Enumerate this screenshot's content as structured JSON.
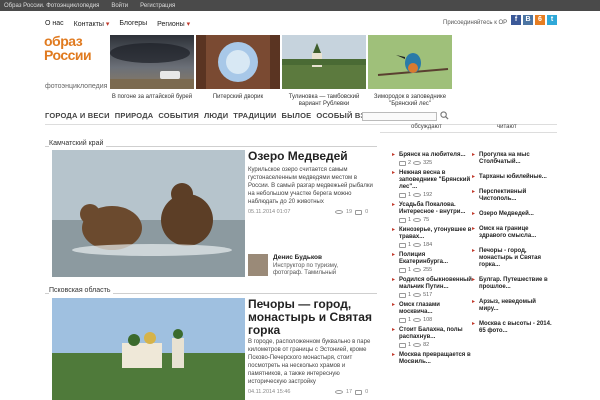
{
  "topbar": {
    "site_name": "Образ России. Фотоэнциклопедия",
    "login": "Войти",
    "register": "Регистрация"
  },
  "topnav": [
    {
      "label": "О нас",
      "dropdown": false
    },
    {
      "label": "Контакты",
      "dropdown": true
    },
    {
      "label": "Блогеры",
      "dropdown": false
    },
    {
      "label": "Регионы",
      "dropdown": true
    }
  ],
  "join_text": "Присоединяйтесь к ОР",
  "social": [
    {
      "name": "facebook-icon",
      "glyph": "f",
      "color": "#3b5998"
    },
    {
      "name": "vk-icon",
      "glyph": "В",
      "color": "#4c75a3"
    },
    {
      "name": "livejournal-icon",
      "glyph": "6",
      "color": "#e67e22"
    },
    {
      "name": "twitter-icon",
      "glyph": "t",
      "color": "#2fa8d8"
    }
  ],
  "logo": {
    "line1": "образ",
    "line2": "России",
    "subtitle": "фотоэнциклопедия",
    "color": "#e07a1f"
  },
  "featured": [
    {
      "caption": "В погоне за алтайской бурей"
    },
    {
      "caption": "Питерский дворик"
    },
    {
      "caption": "Тулиновка — тамбовский вариант Рублевки"
    },
    {
      "caption": "Зимородок в заповеднике \"Брянский лес\""
    }
  ],
  "categories": [
    "ГОРОДА И ВЕСИ",
    "ПРИРОДА",
    "СОБЫТИЯ",
    "ЛЮДИ",
    "ТРАДИЦИИ",
    "БЫЛОЕ",
    "ОСОБЫЙ ВЗГЛЯД"
  ],
  "posts": [
    {
      "region": "Камчатский край",
      "title": "Озеро Медведей",
      "excerpt": "Курильское озеро считается самым густонаселенным медведями местом в России. В самый разгар медвежьей рыбалки на небольшом участке берега можно наблюдать до 20 животных",
      "date": "05.11.2014 01:07",
      "views": "19",
      "comments": "0",
      "author_name": "Денис Будьков",
      "author_desc": "Инструктор по туризму, фотограф. Тамильный"
    },
    {
      "region": "Псковская область",
      "title": "Печоры — город, монастырь и Святая горка",
      "excerpt": "В городе, расположенном буквально в паре километров от границы с Эстонией, кроме Псково-Печерского монастыря, стоит посмотреть на несколько храмов и памятников, а также интересную историческую застройку",
      "date": "04.11.2014 15:46",
      "views": "17",
      "comments": "0"
    }
  ],
  "sidebar": {
    "discussed_header": "обсуждают",
    "read_header": "читают",
    "discussed": [
      {
        "title": "Брянск на любителя...",
        "comments": "2",
        "views": "325"
      },
      {
        "title": "Нежная весна в заповеднике \"Брянский лес\"...",
        "comments": "1",
        "views": "192"
      },
      {
        "title": "Усадьба Покалова. Интересное - внутри...",
        "comments": "1",
        "views": "75"
      },
      {
        "title": "Кинозерье, утонувшее в травах...",
        "comments": "1",
        "views": "184"
      },
      {
        "title": "Полиция Екатеринбурга...",
        "comments": "1",
        "views": "255"
      },
      {
        "title": "Родился обыкновенный мальчик Путин...",
        "comments": "1",
        "views": "517"
      },
      {
        "title": "Омск глазами москвича...",
        "comments": "1",
        "views": "108"
      },
      {
        "title": "Стоит Балахна, полы распахнув...",
        "comments": "1",
        "views": "82"
      },
      {
        "title": "Москва превращается в Мосвиль...",
        "comments": "1",
        "views": ""
      }
    ],
    "read": [
      {
        "title": "Прогулка на мыс Столбчатый..."
      },
      {
        "title": "Тарханы юбилейные..."
      },
      {
        "title": "Перспективный Чистополь..."
      },
      {
        "title": "Озеро Медведей..."
      },
      {
        "title": "Омск на границе здравого смысла..."
      },
      {
        "title": "Печоры - город, монастырь и Святая горка..."
      },
      {
        "title": "Булгар. Путешествие в прошлое..."
      },
      {
        "title": "Арзыз, неведомый миру..."
      },
      {
        "title": "Москва с высоты - 2014. 65 фото..."
      }
    ]
  }
}
